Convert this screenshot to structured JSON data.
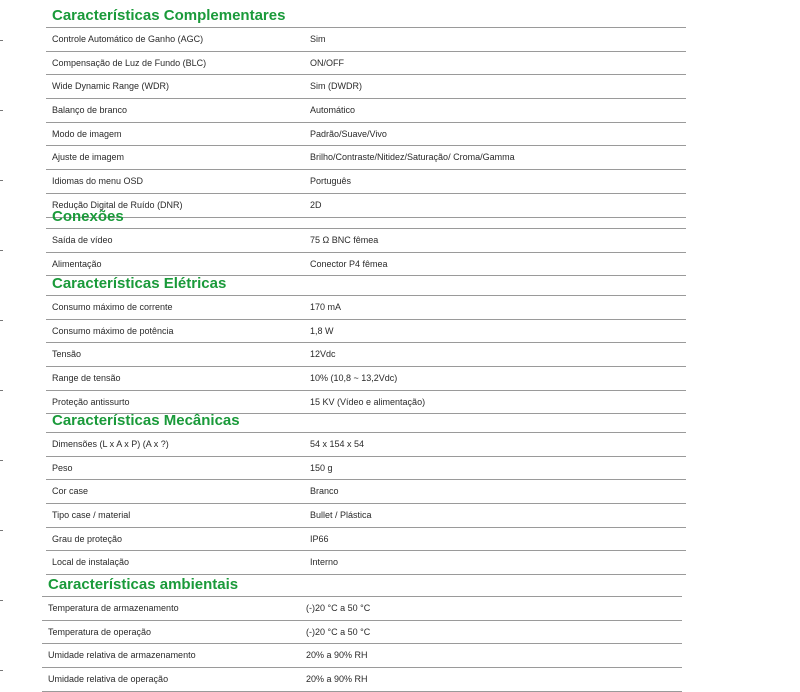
{
  "sections": [
    {
      "title": "Características Complementares",
      "rows": [
        {
          "k": "Controle Automático de Ganho (AGC)",
          "v": "Sim"
        },
        {
          "k": "Compensação de Luz de Fundo (BLC)",
          "v": "ON/OFF"
        },
        {
          "k": "Wide Dynamic Range (WDR)",
          "v": "Sim (DWDR)"
        },
        {
          "k": "Balanço de branco",
          "v": "Automático"
        },
        {
          "k": "Modo de imagem",
          "v": "Padrão/Suave/Vivo"
        },
        {
          "k": "Ajuste de imagem",
          "v": "Brilho/Contraste/Nitidez/Saturação/ Croma/Gamma"
        },
        {
          "k": "Idiomas do menu OSD",
          "v": "Português"
        },
        {
          "k": "Redução Digital de Ruído (DNR)",
          "v": "2D"
        }
      ]
    },
    {
      "title": "Conexões",
      "rows": [
        {
          "k": "Saída de vídeo",
          "v": "75 Ω BNC fêmea"
        },
        {
          "k": "Alimentação",
          "v": "Conector P4 fêmea"
        }
      ]
    },
    {
      "title": "Características Elétricas",
      "rows": [
        {
          "k": "Consumo máximo de corrente",
          "v": "170 mA"
        },
        {
          "k": "Consumo máximo de potência",
          "v": "1,8 W"
        },
        {
          "k": "Tensão",
          "v": "12Vdc"
        },
        {
          "k": "Range de tensão",
          "v": "10% (10,8 ~ 13,2Vdc)"
        },
        {
          "k": "Proteção antissurto",
          "v": "15 KV  (Vídeo e alimentação)"
        }
      ]
    },
    {
      "title": "Características Mecânicas",
      "rows": [
        {
          "k": "Dimensões (L x A x P) (A x ?)",
          "v": "54 x 154 x 54"
        },
        {
          "k": "Peso",
          "v": "150 g"
        },
        {
          "k": "Cor case",
          "v": "Branco"
        },
        {
          "k": "Tipo case / material",
          "v": "Bullet / Plástica"
        },
        {
          "k": "Grau de proteção",
          "v": "IP66"
        },
        {
          "k": "Local de instalação",
          "v": "Interno"
        }
      ]
    },
    {
      "title": "Características ambientais",
      "rows": [
        {
          "k": "Temperatura de armazenamento",
          "v": "(-)20 °C a 50 °C"
        },
        {
          "k": "Temperatura de operação",
          "v": "(-)20 °C a 50 °C"
        },
        {
          "k": "Umidade relativa de armazenamento",
          "v": "20% a 90% RH"
        },
        {
          "k": "Umidade relativa de operação",
          "v": "20% a 90% RH"
        }
      ]
    }
  ]
}
